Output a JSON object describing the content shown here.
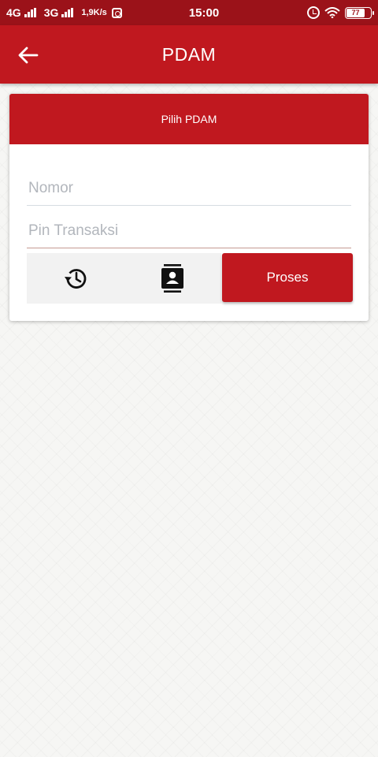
{
  "status_bar": {
    "network1": "4G",
    "network2": "3G",
    "speed": "1,9K/s",
    "time": "15:00",
    "battery": "77"
  },
  "app_bar": {
    "title": "PDAM",
    "back_icon": "arrow-left-icon"
  },
  "form": {
    "select_label": "Pilih PDAM",
    "nomor": {
      "value": "",
      "placeholder": "Nomor"
    },
    "pin": {
      "value": "",
      "placeholder": "Pin Transaksi"
    },
    "history_icon": "history-icon",
    "contacts_icon": "contacts-icon",
    "submit_label": "Proses"
  },
  "colors": {
    "status_bar": "#9b1219",
    "primary": "#c0181f",
    "placeholder": "#b2b6bc",
    "panel": "#f2f2f2"
  }
}
